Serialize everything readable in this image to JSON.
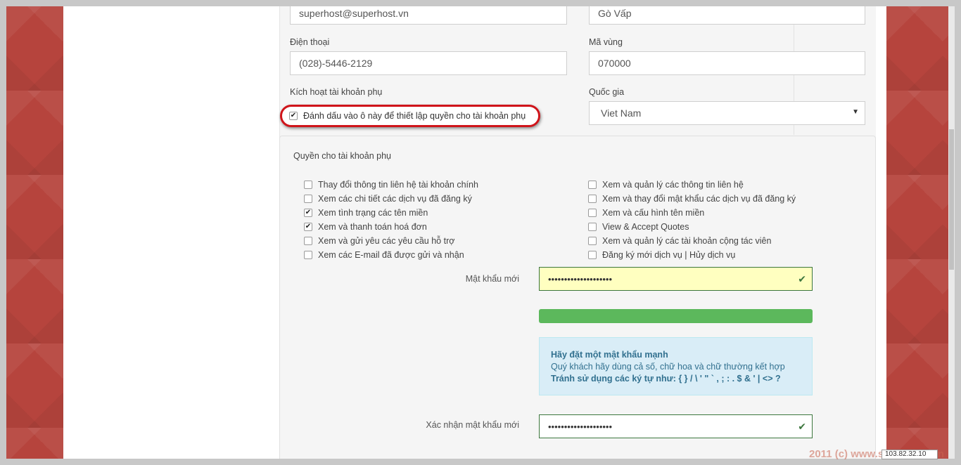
{
  "contact": {
    "email_value": "superhost@superhost.vn",
    "city_value": "Gò Vấp",
    "phone_label": "Điện thoại",
    "phone_value": "(028)-5446-2129",
    "zip_label": "Mã vùng",
    "zip_value": "070000",
    "subaccount_label": "Kích hoạt tài khoản phụ",
    "subaccount_checkbox_label": "Đánh dấu vào ô này để thiết lập quyền cho tài khoản phụ",
    "country_label": "Quốc gia",
    "country_value": "Viet Nam"
  },
  "permissions": {
    "title": "Quyền cho tài khoản phụ",
    "left": [
      {
        "label": "Thay đổi thông tin liên hệ tài khoản chính",
        "checked": false
      },
      {
        "label": "Xem các chi tiết các dịch vụ đã đăng ký",
        "checked": false
      },
      {
        "label": "Xem tình trạng các tên miền",
        "checked": true
      },
      {
        "label": "Xem và thanh toán hoá đơn",
        "checked": true
      },
      {
        "label": "Xem và gửi yêu các yêu cầu hỗ trợ",
        "checked": false
      },
      {
        "label": "Xem các E-mail đã được gửi và nhận",
        "checked": false
      }
    ],
    "right": [
      {
        "label": "Xem và quản lý các thông tin liên hệ",
        "checked": false
      },
      {
        "label": "Xem và thay đổi mật khẩu các dịch vụ đã đăng ký",
        "checked": false
      },
      {
        "label": "Xem và cấu hình tên miền",
        "checked": false
      },
      {
        "label": "View & Accept Quotes",
        "checked": false
      },
      {
        "label": "Xem và quản lý các tài khoản cộng tác viên",
        "checked": false
      },
      {
        "label": "Đăng ký mới dịch vụ | Hủy dịch vụ",
        "checked": false
      }
    ]
  },
  "password": {
    "new_label": "Mật khẩu mới",
    "new_value": "••••••••••••••••••••",
    "strength_percent": 100,
    "hint_title": "Hãy đặt một mật khẩu mạnh",
    "hint_line1": "Quý khách hãy dùng cả số, chữ hoa và chữ thường kết hợp",
    "hint_line2": "Tránh sử dụng các ký tự như: { } / \\ ' \" ` , ; : . $ & ' | <> ?",
    "confirm_label": "Xác nhận mật khẩu mới",
    "confirm_value": "••••••••••••••••••••"
  },
  "footer": {
    "watermark": "2011 (c) www.superhost.vn",
    "ip": "103.82.32.10"
  },
  "colors": {
    "background": "#b9463f",
    "highlight_ring": "#d0141a",
    "success": "#3c763d",
    "strength_bar": "#5cb85c",
    "hint_bg": "#d9edf7"
  }
}
